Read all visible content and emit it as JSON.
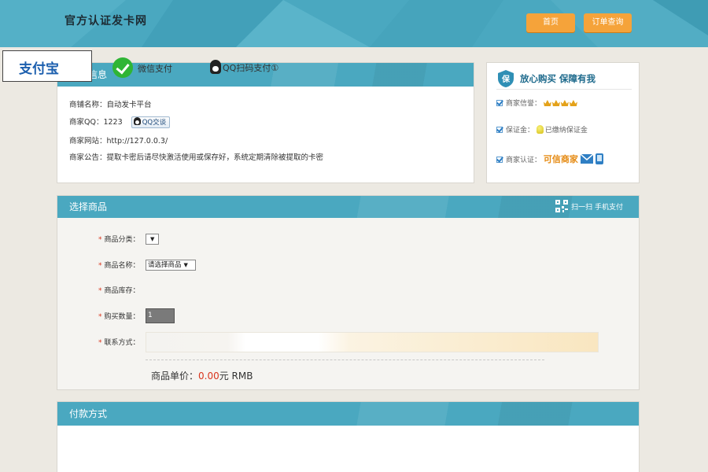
{
  "header": {
    "brand": "官方认证发卡网",
    "nav": {
      "home": "首页",
      "orders": "订单查询"
    }
  },
  "merchant": {
    "title": "商家信息",
    "shop_name_label": "商铺名称：",
    "shop_name": "自动发卡平台",
    "qq_label": "商家QQ：",
    "qq": "1223",
    "qq_button": "QQ交谈",
    "site_label": "商家网站：",
    "site": "http://127.0.0.3/",
    "notice_label": "商家公告：",
    "notice": "提取卡密后请尽快激活使用或保存好，系统定期清除被提取的卡密"
  },
  "guarantee": {
    "title": "放心购买  保障有我",
    "credit_label": "商家信誉：",
    "deposit_label": "保证金：",
    "deposit_value": "已缴纳保证金",
    "cert_label": "商家认证：",
    "cert_value": "可信商家",
    "credit_crowns": 4
  },
  "goods": {
    "title": "选择商品",
    "scan_pay": "扫一扫 手机支付",
    "category_label": "商品分类：",
    "category_value": "",
    "name_label": "商品名称：",
    "name_value": "请选择商品",
    "stock_label": "商品库存：",
    "qty_label": "购买数量：",
    "qty_value": "1",
    "contact_label": "联系方式：",
    "price_label": "商品单价：",
    "price_value": "0.00",
    "price_unit": "元 RMB"
  },
  "payment": {
    "title": "付款方式",
    "alipay": "支付宝",
    "wechat": "微信支付",
    "qq": "QQ扫码支付①"
  },
  "colors": {
    "primary": "#4aa8c0",
    "accent": "#f5a33a",
    "price": "#d9341c"
  },
  "icons": [
    "shield-icon",
    "check-icon",
    "crown-icon",
    "bulb-icon",
    "mail-icon",
    "phone-icon",
    "qr-code-icon",
    "qq-penguin-icon",
    "wechat-icon"
  ]
}
